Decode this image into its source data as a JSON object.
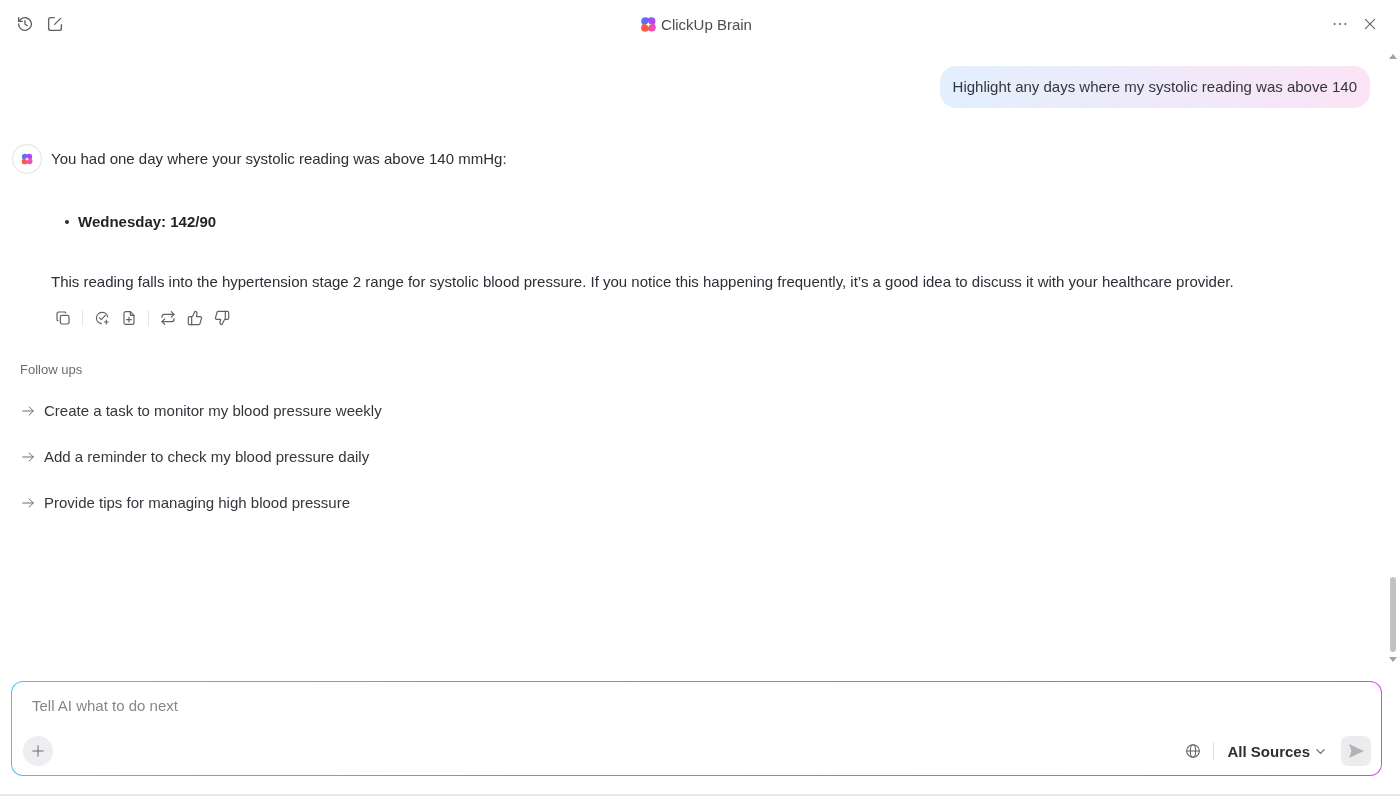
{
  "header": {
    "title": "ClickUp Brain"
  },
  "messages": [
    {
      "kind": "user",
      "text": "Highlight any days where my systolic reading was above 140"
    },
    {
      "kind": "assistant",
      "intro": "You had one day where your systolic reading was above 140 mmHg:",
      "bullets": [
        "Wednesday: 142/90"
      ],
      "body": "This reading falls into the hypertension stage 2 range for systolic blood pressure. If you notice this happening frequently, it’s a good idea to discuss it with your healthcare provider."
    }
  ],
  "follow_ups": {
    "heading": "Follow ups",
    "items": [
      "Create a task to monitor my blood pressure weekly",
      "Add a reminder to check my blood pressure daily",
      "Provide tips for managing high blood pressure"
    ]
  },
  "composer": {
    "placeholder": "Tell AI what to do next",
    "sources_label": "All Sources"
  }
}
